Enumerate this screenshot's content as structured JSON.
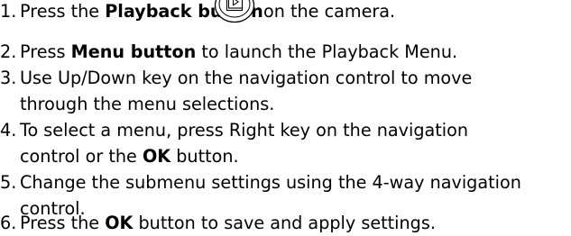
{
  "steps": [
    {
      "num": "1.",
      "pre": "Press the ",
      "bold": "Playback button",
      "post": "on the camera.",
      "icon": "playback-button-icon"
    },
    {
      "num": "2.",
      "pre": "Press ",
      "bold": "Menu button",
      "post": " to launch the Playback Menu."
    },
    {
      "num": "3.",
      "line1": "Use Up/Down key on the navigation control to move",
      "line2": "through the menu selections."
    },
    {
      "num": "4.",
      "line1": "To select a menu, press Right key on the navigation",
      "line2_pre": "control or the ",
      "line2_bold": "OK",
      "line2_post": " button."
    },
    {
      "num": "5.",
      "line1": "Change the submenu settings using the 4-way navigation",
      "line2": "control."
    },
    {
      "num": "6.",
      "pre": "Press the ",
      "bold": "OK",
      "post": " button to save and apply settings."
    }
  ]
}
